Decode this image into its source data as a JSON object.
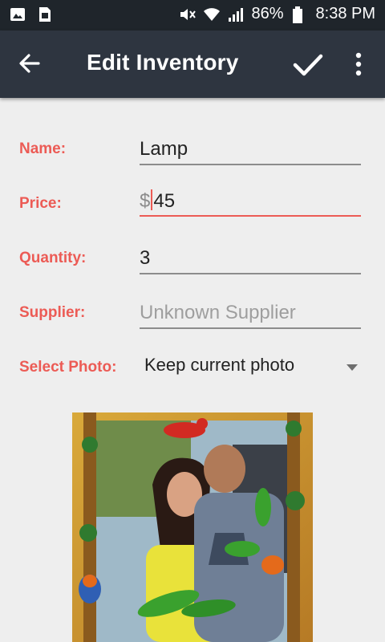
{
  "status_bar": {
    "battery": "86%",
    "time": "8:38 PM",
    "icons": [
      "gallery-icon",
      "sim-icon",
      "mute-icon",
      "wifi-icon",
      "signal-icon",
      "battery-icon"
    ]
  },
  "app_bar": {
    "title": "Edit Inventory",
    "icons": [
      "back-arrow-icon",
      "checkmark-icon",
      "more-vert-icon"
    ]
  },
  "form": {
    "name": {
      "label": "Name:",
      "value": "Lamp"
    },
    "price": {
      "label": "Price:",
      "prefix": "$",
      "value": "45"
    },
    "quantity": {
      "label": "Quantity:",
      "value": "3"
    },
    "supplier": {
      "label": "Supplier:",
      "placeholder": "Unknown Supplier"
    },
    "photo_select": {
      "label": "Select Photo:",
      "selected": "Keep current photo"
    }
  },
  "colors": {
    "accent": "#ec5b55",
    "app_bar": "#2e3540",
    "status_bar": "#1f252b",
    "background": "#eeeeee"
  }
}
